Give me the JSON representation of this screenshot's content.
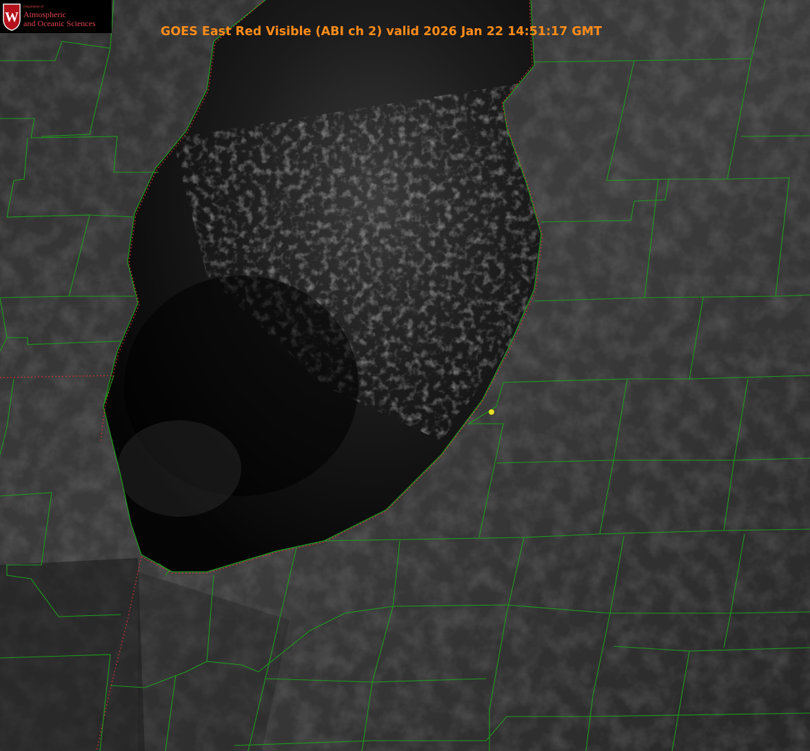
{
  "title": "GOES East Red Visible (ABI ch 2) valid 2026 Jan 22 14:51:17 GMT",
  "logo": {
    "dept": "Department of",
    "line1": "Atmospheric",
    "line2": "and Oceanic Sciences",
    "seal_letter": "W"
  },
  "colors": {
    "county_lines": "#1f9e1f",
    "state_boundary": "#d03030",
    "marker": "#e8e020",
    "title": "#ff8c1a",
    "logo_text": "#e0454f",
    "logo_seal": "#b5121b"
  },
  "icons": {
    "marker": "yellow-dot-marker",
    "logo": "uw-seal-icon"
  }
}
